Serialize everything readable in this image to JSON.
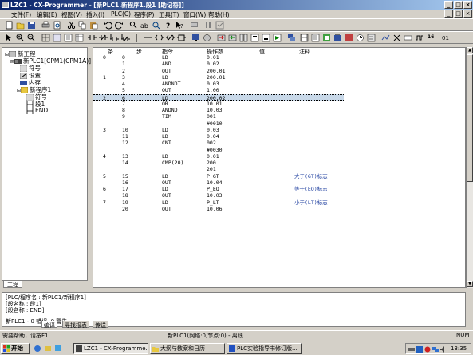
{
  "window": {
    "title": "LZC1 - CX-Programmer - [新PLC1.新程序1.段1 [助记符]]"
  },
  "menu": [
    "文件(F)",
    "编辑(E)",
    "视图(V)",
    "插入(I)",
    "PLC(C)",
    "程序(P)",
    "工具(T)",
    "窗口(W)",
    "帮助(H)"
  ],
  "tree": {
    "root": "新工程",
    "plc": "新PLC1[CPM1(CPM1A)]",
    "items": [
      "符号",
      "设置",
      "内存"
    ],
    "program": "新程序1",
    "program_items": [
      "符号",
      "段1",
      "END"
    ],
    "tab": "工程"
  },
  "program": {
    "headers": [
      "条",
      "步",
      "指令",
      "操作数",
      "值",
      "注释"
    ],
    "rows": [
      {
        "rung": "0",
        "step": "0",
        "instr": "LD",
        "operand": "0.01",
        "comment": ""
      },
      {
        "rung": "",
        "step": "1",
        "instr": "AND",
        "operand": "0.02",
        "comment": ""
      },
      {
        "rung": "",
        "step": "2",
        "instr": "OUT",
        "operand": "200.01",
        "comment": ""
      },
      {
        "rung": "1",
        "step": "3",
        "instr": "LD",
        "operand": "200.01",
        "comment": ""
      },
      {
        "rung": "",
        "step": "4",
        "instr": "ANDNOT",
        "operand": "0.03",
        "comment": ""
      },
      {
        "rung": "",
        "step": "5",
        "instr": "OUT",
        "operand": "1.00",
        "comment": ""
      },
      {
        "rung": "2",
        "step": "6",
        "instr": "LD",
        "operand": "200.02",
        "comment": ""
      },
      {
        "rung": "",
        "step": "7",
        "instr": "OR",
        "operand": "10.01",
        "comment": ""
      },
      {
        "rung": "",
        "step": "8",
        "instr": "ANDNOT",
        "operand": "10.03",
        "comment": ""
      },
      {
        "rung": "",
        "step": "9",
        "instr": "TIM",
        "operand": "001",
        "comment": ""
      },
      {
        "rung": "",
        "step": "",
        "instr": "",
        "operand": "#0010",
        "comment": ""
      },
      {
        "rung": "3",
        "step": "10",
        "instr": "LD",
        "operand": "0.03",
        "comment": ""
      },
      {
        "rung": "",
        "step": "11",
        "instr": "LD",
        "operand": "0.04",
        "comment": ""
      },
      {
        "rung": "",
        "step": "12",
        "instr": "CNT",
        "operand": "002",
        "comment": ""
      },
      {
        "rung": "",
        "step": "",
        "instr": "",
        "operand": "#0030",
        "comment": ""
      },
      {
        "rung": "4",
        "step": "13",
        "instr": "LD",
        "operand": "0.01",
        "comment": ""
      },
      {
        "rung": "",
        "step": "14",
        "instr": "CMP(20)",
        "operand": "200",
        "comment": ""
      },
      {
        "rung": "",
        "step": "",
        "instr": "",
        "operand": "201",
        "comment": ""
      },
      {
        "rung": "5",
        "step": "15",
        "instr": "LD",
        "operand": "P_GT",
        "comment": "大于(GT)标志"
      },
      {
        "rung": "",
        "step": "16",
        "instr": "OUT",
        "operand": "10.04",
        "comment": ""
      },
      {
        "rung": "6",
        "step": "17",
        "instr": "LD",
        "operand": "P_EQ",
        "comment": "等于(EQ)标志"
      },
      {
        "rung": "",
        "step": "18",
        "instr": "OUT",
        "operand": "10.03",
        "comment": ""
      },
      {
        "rung": "7",
        "step": "19",
        "instr": "LD",
        "operand": "P_LT",
        "comment": "小于(LT)标志"
      },
      {
        "rung": "",
        "step": "20",
        "instr": "OUT",
        "operand": "10.06",
        "comment": ""
      }
    ],
    "selected_row": 6
  },
  "output": {
    "lines": [
      "[PLC/程序名 : 新PLC1/新程序1]",
      "[段名称 : 段1]",
      "[段名称 : END]",
      "",
      "新PLC1 - 0 错误, 0 警告."
    ],
    "tabs": [
      "编译",
      "寻找报表",
      "传送"
    ]
  },
  "status": {
    "help": "需要帮助，请按F1",
    "plc": "新PLC1(网络:0,节点:0) - 离线",
    "mode": "NUM"
  },
  "taskbar": {
    "start": "开始",
    "tasks": [
      "LZC1 - CX-Programme...",
      "大纲与教案和日历",
      "PLC实验指导书修订版..."
    ],
    "clock": "13:35"
  }
}
